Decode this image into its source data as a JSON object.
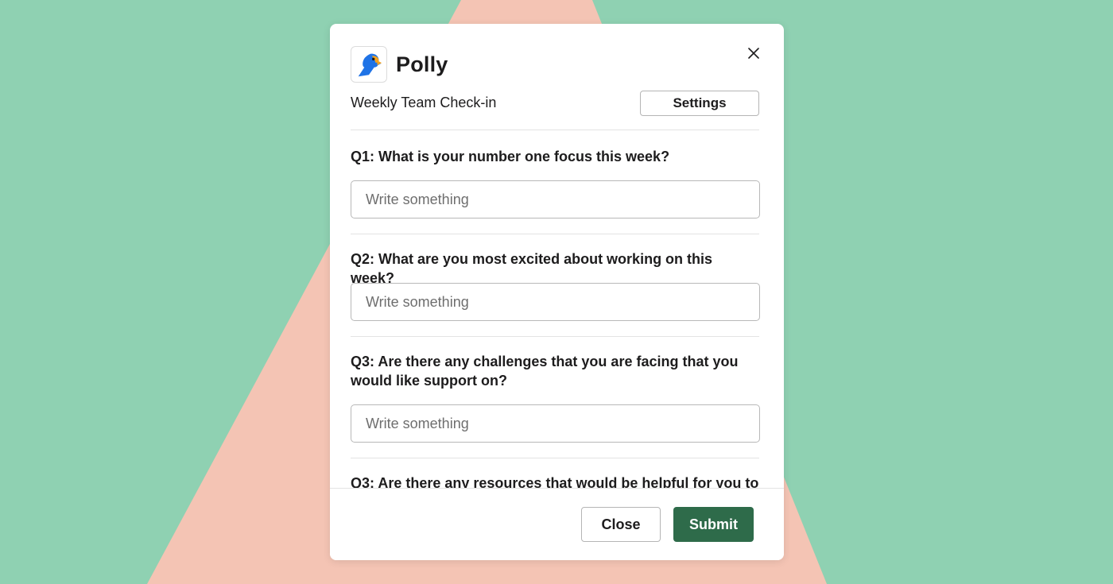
{
  "app": {
    "name": "Polly",
    "icon": "polly-parrot-logo"
  },
  "modal": {
    "subtitle": "Weekly Team Check-in",
    "settings_label": "Settings",
    "close_icon": "close-icon"
  },
  "questions": [
    {
      "text": "Q1: What is your number one focus this week?",
      "placeholder": "Write something"
    },
    {
      "text": "Q2: What are you most excited about working on this week?",
      "placeholder": "Write something"
    },
    {
      "text": "Q3: Are there any challenges that you are facing that you would like support on?",
      "placeholder": "Write something"
    },
    {
      "text": "Q3: Are there any resources that would be helpful for you to"
    }
  ],
  "footer": {
    "close_label": "Close",
    "submit_label": "Submit"
  },
  "colors": {
    "background_green": "#8fd1b2",
    "background_salmon": "#f4c4b4",
    "submit_button": "#2e6b4a",
    "logo_blue": "#1f73e6",
    "logo_orange": "#f7a21b"
  }
}
